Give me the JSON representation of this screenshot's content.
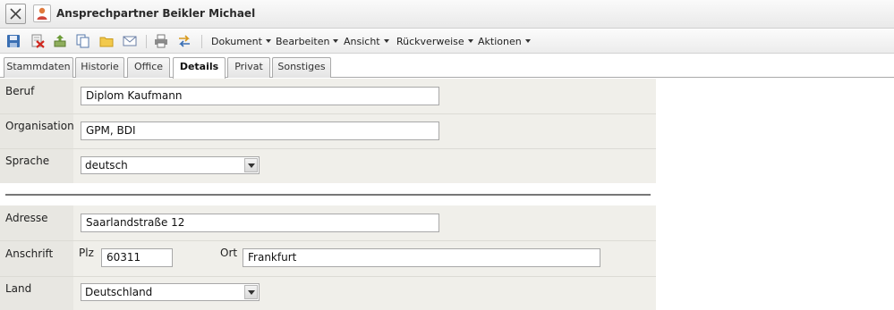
{
  "window": {
    "title": "Ansprechpartner Beikler Michael"
  },
  "toolbar": {
    "icons": [
      "save-icon",
      "delete-icon",
      "print-export-icon",
      "copy-icon",
      "folder-icon",
      "mail-icon",
      "printer-icon",
      "switch-icon"
    ],
    "menus": [
      "Dokument",
      "Bearbeiten",
      "Ansicht",
      "Rückverweise",
      "Aktionen"
    ]
  },
  "tabs": [
    "Stammdaten",
    "Historie",
    "Office",
    "Details",
    "Privat",
    "Sonstiges"
  ],
  "active_tab": "Details",
  "form": {
    "beruf": {
      "label": "Beruf",
      "value": "Diplom Kaufmann"
    },
    "organisation": {
      "label": "Organisation",
      "value": "GPM, BDI"
    },
    "sprache": {
      "label": "Sprache",
      "value": "deutsch"
    },
    "adresse": {
      "label": "Adresse",
      "value": "Saarlandstraße 12"
    },
    "anschrift": {
      "label": "Anschrift",
      "plz_label": "Plz",
      "plz_value": "60311",
      "ort_label": "Ort",
      "ort_value": "Frankfurt"
    },
    "land": {
      "label": "Land",
      "value": "Deutschland"
    }
  },
  "colors": {
    "form_background": "#f0efea",
    "label_column": "#e8e7e2",
    "title_text": "#2a2a2a"
  }
}
